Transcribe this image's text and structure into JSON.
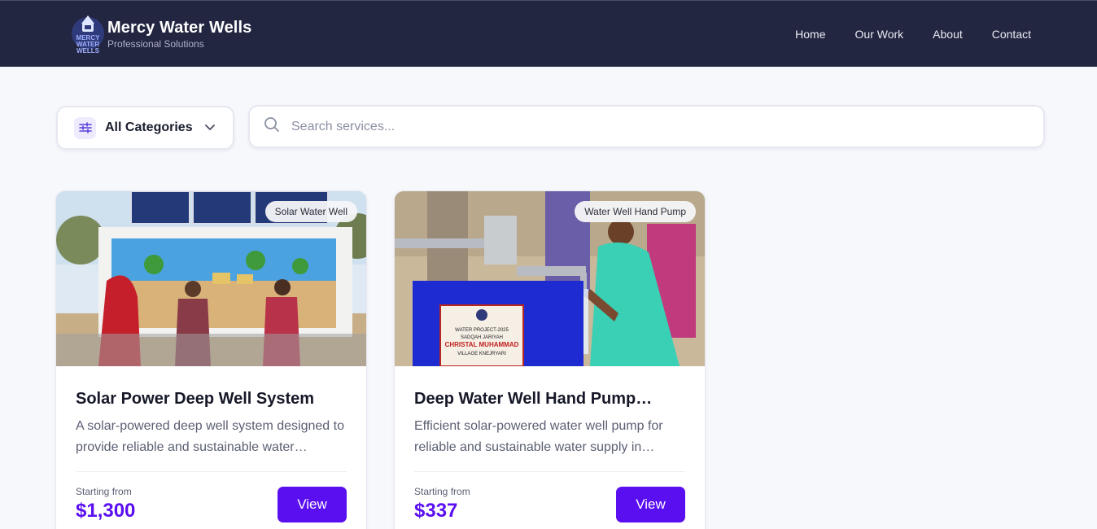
{
  "header": {
    "brand_title": "Mercy Water Wells",
    "brand_subtitle": "Professional Solutions",
    "logo_text": [
      "MERCY",
      "WATER",
      "WELLS"
    ],
    "nav": [
      {
        "label": "Home"
      },
      {
        "label": "Our Work"
      },
      {
        "label": "About"
      },
      {
        "label": "Contact"
      }
    ]
  },
  "filters": {
    "category_icon": "sliders-icon",
    "category_selected": "All Categories",
    "search_placeholder": "Search services..."
  },
  "cards": [
    {
      "badge": "Solar Water Well",
      "title": "Solar Power Deep Well System",
      "description": "A solar-powered deep well system designed to provide reliable and sustainable water…",
      "price_label": "Starting from",
      "price": "$1,300",
      "button": "View"
    },
    {
      "badge": "Water Well Hand Pump",
      "title": "Deep Water Well Hand Pump…",
      "description": "Efficient solar-powered water well pump for reliable and sustainable water supply in…",
      "price_label": "Starting from",
      "price": "$337",
      "button": "View",
      "plaque_lines": [
        "WATER PROJECT-2025",
        "SADQAH JARIYAH",
        "CHRISTAL MUHAMMAD",
        "VILLAGE KNEJRYARI"
      ]
    }
  ],
  "colors": {
    "header_bg": "#232640",
    "accent": "#5a0ff0",
    "page_bg": "#f7f8fc"
  }
}
